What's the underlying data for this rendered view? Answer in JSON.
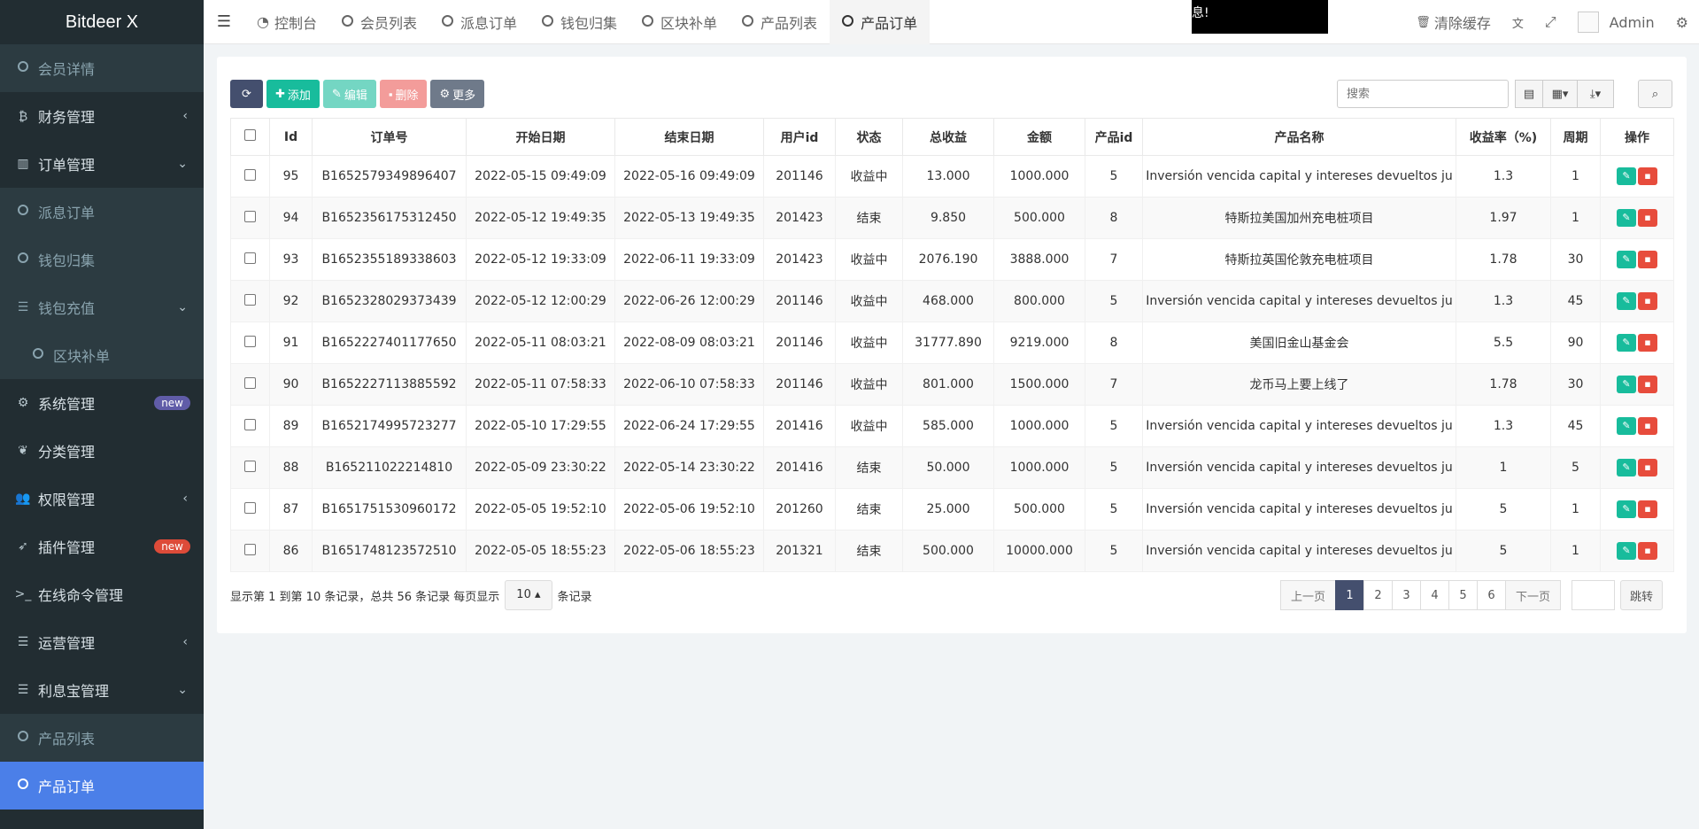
{
  "brand": "Bitdeer X",
  "sidebar": {
    "items": [
      {
        "label": "会员详情",
        "icon": "circle-icon",
        "type": "sub"
      },
      {
        "label": "财务管理",
        "icon": "bitcoin-icon",
        "type": "main",
        "arrow": "‹"
      },
      {
        "label": "订单管理",
        "icon": "bar-chart-icon",
        "type": "main",
        "arrow": "⌄"
      },
      {
        "label": "派息订单",
        "icon": "circle-icon",
        "type": "sub"
      },
      {
        "label": "钱包归集",
        "icon": "circle-icon",
        "type": "sub"
      },
      {
        "label": "钱包充值",
        "icon": "list-icon",
        "type": "sub",
        "arrow": "⌄"
      },
      {
        "label": "区块补单",
        "icon": "circle-icon",
        "type": "sub2"
      },
      {
        "label": "系统管理",
        "icon": "cogs-icon",
        "type": "main",
        "badge": "new",
        "badge_color": "purple"
      },
      {
        "label": "分类管理",
        "icon": "leaf-icon",
        "type": "main"
      },
      {
        "label": "权限管理",
        "icon": "users-icon",
        "type": "main",
        "arrow": "‹"
      },
      {
        "label": "插件管理",
        "icon": "rocket-icon",
        "type": "main",
        "badge": "new",
        "badge_color": "red"
      },
      {
        "label": "在线命令管理",
        "icon": "terminal-icon",
        "type": "main"
      },
      {
        "label": "运营管理",
        "icon": "list-icon",
        "type": "main",
        "arrow": "‹"
      },
      {
        "label": "利息宝管理",
        "icon": "list-icon",
        "type": "main",
        "arrow": "⌄"
      },
      {
        "label": "产品列表",
        "icon": "circle-icon",
        "type": "sub"
      },
      {
        "label": "产品订单",
        "icon": "circle-icon",
        "type": "active"
      }
    ]
  },
  "topbar": {
    "tabs": [
      {
        "label": "控制台",
        "icon": "dashboard-icon"
      },
      {
        "label": "会员列表",
        "icon": "circle-icon"
      },
      {
        "label": "派息订单",
        "icon": "circle-icon"
      },
      {
        "label": "钱包归集",
        "icon": "circle-icon"
      },
      {
        "label": "区块补单",
        "icon": "circle-icon"
      },
      {
        "label": "产品列表",
        "icon": "circle-icon"
      },
      {
        "label": "产品订单",
        "icon": "circle-icon",
        "active": true
      }
    ],
    "notice": "息!",
    "clear_cache": "清除缓存",
    "admin": "Admin"
  },
  "toolbar": {
    "add": "添加",
    "edit": "编辑",
    "delete": "删除",
    "more": "更多",
    "search_placeholder": "搜索"
  },
  "table": {
    "columns": [
      "Id",
      "订单号",
      "开始日期",
      "结束日期",
      "用户id",
      "状态",
      "总收益",
      "金额",
      "产品id",
      "产品名称",
      "收益率（%)",
      "周期",
      "操作"
    ],
    "rows": [
      [
        "95",
        "B1652579349896407",
        "2022-05-15 09:49:09",
        "2022-05-16 09:49:09",
        "201146",
        "收益中",
        "13.000",
        "1000.000",
        "5",
        "Inversión vencida capital y intereses devueltos ju",
        "1.3",
        "1"
      ],
      [
        "94",
        "B1652356175312450",
        "2022-05-12 19:49:35",
        "2022-05-13 19:49:35",
        "201423",
        "结束",
        "9.850",
        "500.000",
        "8",
        "特斯拉美国加州充电桩项目",
        "1.97",
        "1"
      ],
      [
        "93",
        "B1652355189338603",
        "2022-05-12 19:33:09",
        "2022-06-11 19:33:09",
        "201423",
        "收益中",
        "2076.190",
        "3888.000",
        "7",
        "特斯拉英国伦敦充电桩项目",
        "1.78",
        "30"
      ],
      [
        "92",
        "B1652328029373439",
        "2022-05-12 12:00:29",
        "2022-06-26 12:00:29",
        "201146",
        "收益中",
        "468.000",
        "800.000",
        "5",
        "Inversión vencida capital y intereses devueltos ju",
        "1.3",
        "45"
      ],
      [
        "91",
        "B1652227401177650",
        "2022-05-11 08:03:21",
        "2022-08-09 08:03:21",
        "201146",
        "收益中",
        "31777.890",
        "9219.000",
        "8",
        "美国旧金山基金会",
        "5.5",
        "90"
      ],
      [
        "90",
        "B1652227113885592",
        "2022-05-11 07:58:33",
        "2022-06-10 07:58:33",
        "201146",
        "收益中",
        "801.000",
        "1500.000",
        "7",
        "龙币马上要上线了",
        "1.78",
        "30"
      ],
      [
        "89",
        "B1652174995723277",
        "2022-05-10 17:29:55",
        "2022-06-24 17:29:55",
        "201416",
        "收益中",
        "585.000",
        "1000.000",
        "5",
        "Inversión vencida capital y intereses devueltos ju",
        "1.3",
        "45"
      ],
      [
        "88",
        "B165211022214810",
        "2022-05-09 23:30:22",
        "2022-05-14 23:30:22",
        "201416",
        "结束",
        "50.000",
        "1000.000",
        "5",
        "Inversión vencida capital y intereses devueltos ju",
        "1",
        "5"
      ],
      [
        "87",
        "B1651751530960172",
        "2022-05-05 19:52:10",
        "2022-05-06 19:52:10",
        "201260",
        "结束",
        "25.000",
        "500.000",
        "5",
        "Inversión vencida capital y intereses devueltos ju",
        "5",
        "1"
      ],
      [
        "86",
        "B1651748123572510",
        "2022-05-05 18:55:23",
        "2022-05-06 18:55:23",
        "201321",
        "结束",
        "500.000",
        "10000.000",
        "5",
        "Inversión vencida capital y intereses devueltos ju",
        "5",
        "1"
      ]
    ]
  },
  "footer": {
    "info_prefix": "显示第 1 到第 10 条记录，总共 56 条记录 每页显示",
    "page_size": "10",
    "info_suffix": "条记录",
    "prev": "上一页",
    "pages": [
      "1",
      "2",
      "3",
      "4",
      "5",
      "6"
    ],
    "active_page": "1",
    "next": "下一页",
    "jump": "跳转"
  },
  "colors": {
    "sidebar_bg": "#222d32",
    "active_item": "#4b7fe8",
    "accent_green": "#18bc9c",
    "accent_red": "#e74c3c",
    "dark_button": "#444f6e"
  }
}
